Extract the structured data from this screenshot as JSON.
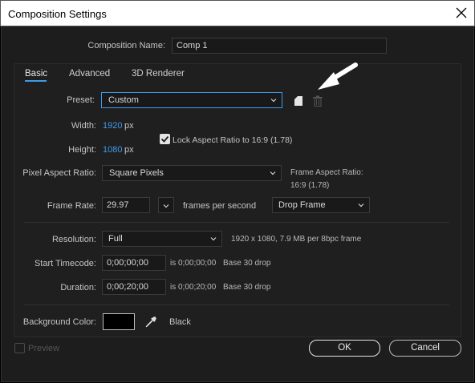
{
  "window": {
    "title": "Composition Settings"
  },
  "comp_name": {
    "label": "Composition Name:",
    "value": "Comp 1"
  },
  "tabs": [
    {
      "label": "Basic",
      "active": true
    },
    {
      "label": "Advanced",
      "active": false
    },
    {
      "label": "3D Renderer",
      "active": false
    }
  ],
  "preset": {
    "label": "Preset:",
    "value": "Custom"
  },
  "width": {
    "label": "Width:",
    "value": "1920",
    "unit": "px"
  },
  "height": {
    "label": "Height:",
    "value": "1080",
    "unit": "px"
  },
  "lock_aspect": {
    "label": "Lock Aspect Ratio to 16:9 (1.78)",
    "checked": true
  },
  "pixel_aspect": {
    "label": "Pixel Aspect Ratio:",
    "value": "Square Pixels"
  },
  "frame_aspect": {
    "line1": "Frame Aspect Ratio:",
    "line2": "16:9 (1.78)"
  },
  "frame_rate": {
    "label": "Frame Rate:",
    "value": "29.97",
    "units": "frames per second",
    "drop": "Drop Frame"
  },
  "resolution": {
    "label": "Resolution:",
    "value": "Full",
    "info": "1920 x 1080, 7.9 MB per 8bpc frame"
  },
  "start_timecode": {
    "label": "Start Timecode:",
    "value": "0;00;00;00",
    "is_text": "is 0;00;00;00",
    "base": "Base 30  drop"
  },
  "duration": {
    "label": "Duration:",
    "value": "0;00;20;00",
    "is_text": "is 0;00;20;00",
    "base": "Base 30  drop"
  },
  "background": {
    "label": "Background Color:",
    "color_name": "Black",
    "swatch": "#000000"
  },
  "preview": {
    "label": "Preview",
    "checked": false
  },
  "buttons": {
    "ok": "OK",
    "cancel": "Cancel"
  },
  "colors": {
    "accent": "#3d9bec",
    "dialog_bg": "#1d1d1d"
  }
}
